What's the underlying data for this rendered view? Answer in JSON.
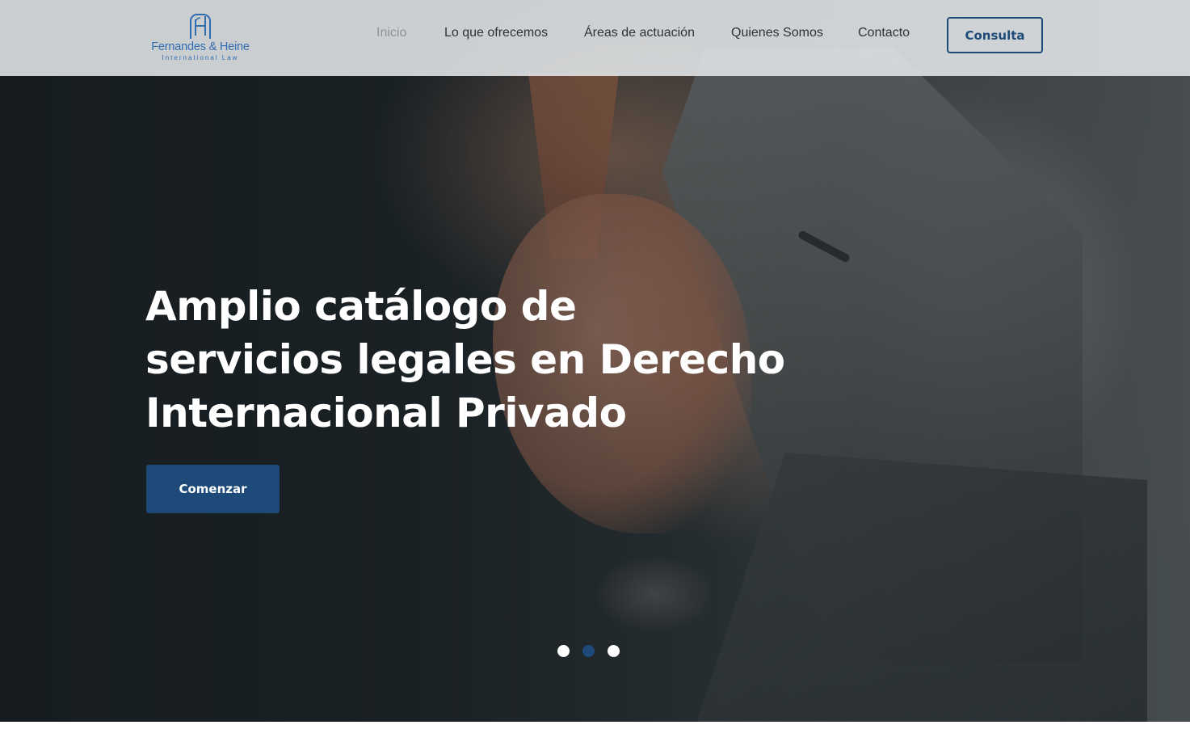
{
  "brand": {
    "name": "Fernandes & Heine",
    "tagline": "International Law",
    "logo_icon": "fh-monogram-icon",
    "color": "#2f6db0"
  },
  "nav": {
    "items": [
      {
        "label": "Inicio",
        "active": true
      },
      {
        "label": "Lo que ofrecemos",
        "active": false
      },
      {
        "label": "Áreas de actuación",
        "active": false
      },
      {
        "label": "Quienes Somos",
        "active": false
      },
      {
        "label": "Contacto",
        "active": false
      }
    ],
    "cta_label": "Consulta"
  },
  "hero": {
    "headline_lines": [
      "Amplio catálogo de",
      "servicios legales en Derecho",
      "Internacional Privado"
    ],
    "cta_label": "Comenzar",
    "slider": {
      "count": 3,
      "active_index": 1
    }
  },
  "colors": {
    "accent": "#1d4a78",
    "header_bg": "#e4e7e9",
    "nav_text": "#2e3336",
    "nav_active_text": "#8d9396",
    "headline_text": "#ffffff"
  }
}
